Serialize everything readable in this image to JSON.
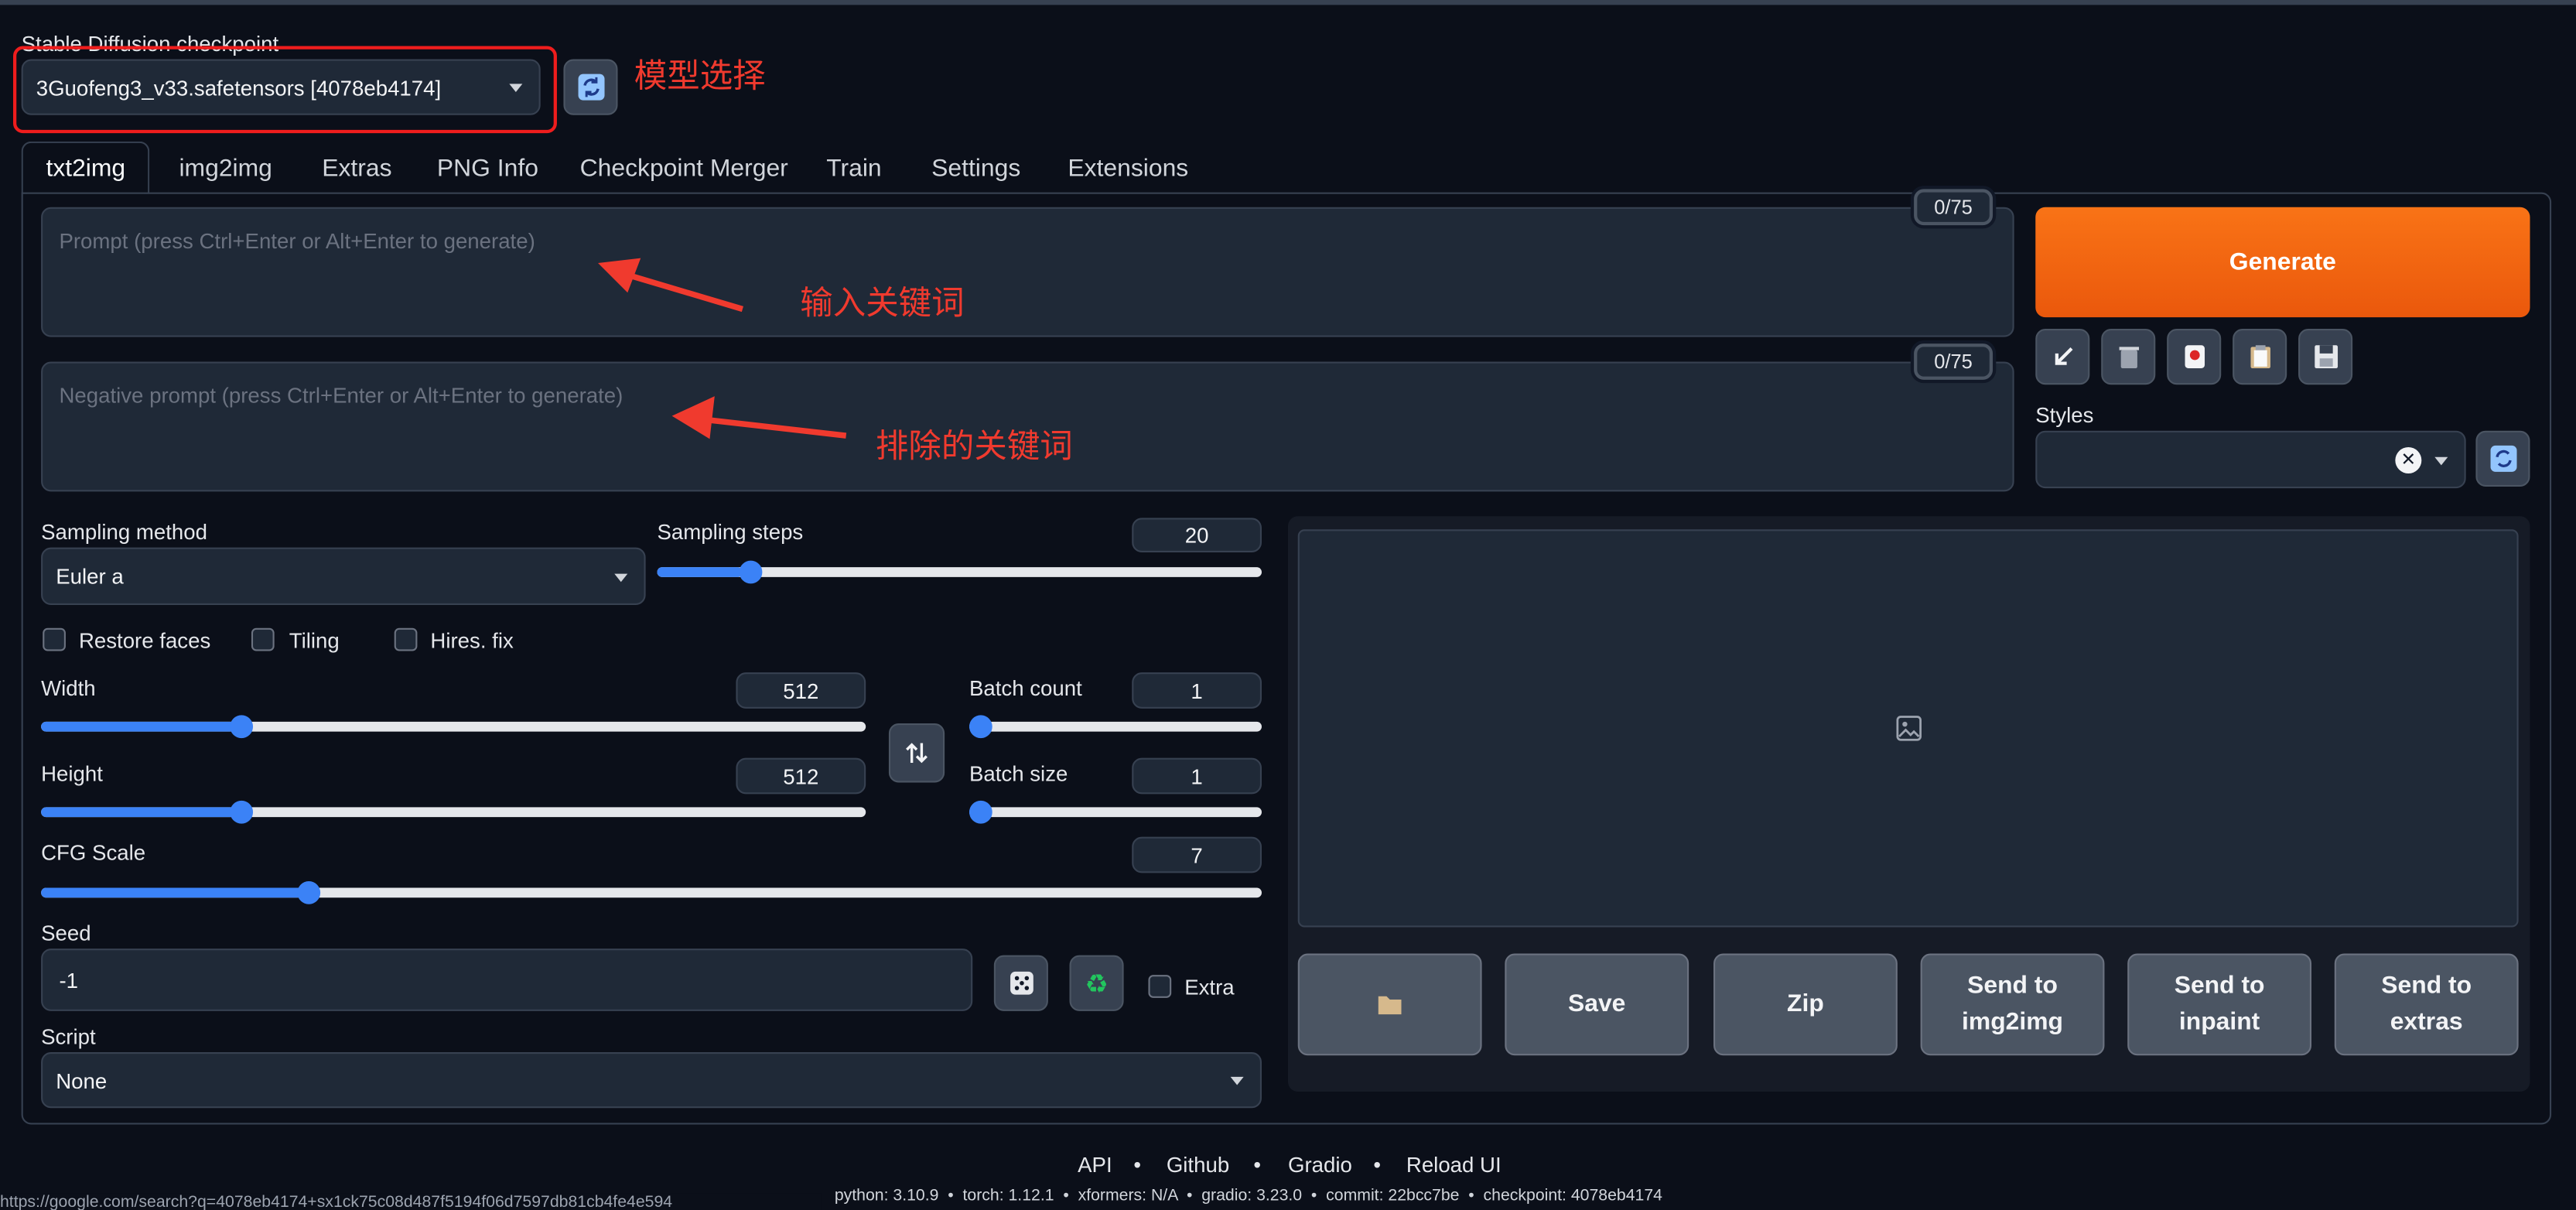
{
  "checkpoint": {
    "label": "Stable Diffusion checkpoint",
    "selected": "3Guofeng3_v33.safetensors [4078eb4174]"
  },
  "annotations": {
    "model_select": "模型选择",
    "prompt": "输入关键词",
    "negative": "排除的关键词"
  },
  "tabs": [
    "txt2img",
    "img2img",
    "Extras",
    "PNG Info",
    "Checkpoint Merger",
    "Train",
    "Settings",
    "Extensions"
  ],
  "prompt": {
    "placeholder": "Prompt (press Ctrl+Enter or Alt+Enter to generate)",
    "counter": "0/75"
  },
  "negative_prompt": {
    "placeholder": "Negative prompt (press Ctrl+Enter or Alt+Enter to generate)",
    "counter": "0/75"
  },
  "generate_label": "Generate",
  "styles": {
    "label": "Styles",
    "value": ""
  },
  "sampling": {
    "method_label": "Sampling method",
    "method_value": "Euler a"
  },
  "sampling_steps": {
    "label": "Sampling steps",
    "value": "20",
    "fraction": 0.14
  },
  "checkboxes": {
    "restore_faces": "Restore faces",
    "tiling": "Tiling",
    "hires_fix": "Hires. fix",
    "extra": "Extra"
  },
  "width": {
    "label": "Width",
    "value": "512",
    "fraction": 0.236
  },
  "height": {
    "label": "Height",
    "value": "512",
    "fraction": 0.236
  },
  "batch_count": {
    "label": "Batch count",
    "value": "1",
    "fraction": 0.0
  },
  "batch_size": {
    "label": "Batch size",
    "value": "1",
    "fraction": 0.0
  },
  "cfg_scale": {
    "label": "CFG Scale",
    "value": "7",
    "fraction": 0.214
  },
  "seed": {
    "label": "Seed",
    "value": "-1"
  },
  "script": {
    "label": "Script",
    "value": "None"
  },
  "actions": {
    "save": "Save",
    "zip": "Zip",
    "send_img2img": "Send to img2img",
    "send_inpaint": "Send to inpaint",
    "send_extras": "Send to extras"
  },
  "footer": {
    "links": [
      "API",
      "Github",
      "Gradio",
      "Reload UI"
    ],
    "info": "python: 3.10.9  •  torch: 1.12.1  •  xformers: N/A  •  gradio: 3.23.0  •  commit: 22bcc7be  •  checkpoint: 4078eb4174"
  },
  "status_url": "https://google.com/search?q=4078eb4174+sx1ck75c08d487f5194f06d7597db81cb4fe4e594",
  "colors": {
    "accent": "#f97316",
    "slider": "#3b82f6",
    "annotation": "#f03a2e"
  }
}
